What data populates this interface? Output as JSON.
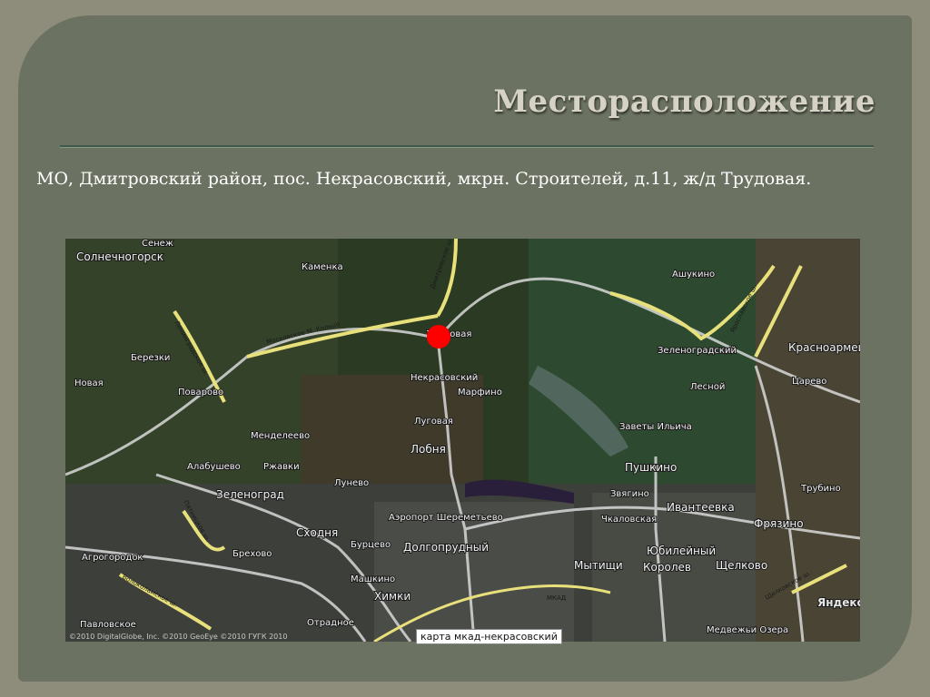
{
  "slide": {
    "title": "Месторасположение",
    "address": "МО, Дмитровский район, пос. Некрасовский, мкрн. Строителей, д.11, ж/д Трудовая."
  },
  "map": {
    "caption": "карта мкад-некрасовский",
    "copyright": "©2010 DigitalGlobe, Inc. ©2010 GeoEye ©2010 ГУГК 2010",
    "logo": "Яндекс",
    "marker_color": "#ff0000",
    "places": [
      {
        "name": "Сенеж"
      },
      {
        "name": "Солнечногорск"
      },
      {
        "name": "Каменка"
      },
      {
        "name": "Трудовая"
      },
      {
        "name": "Ашукино"
      },
      {
        "name": "Березки"
      },
      {
        "name": "Поварово"
      },
      {
        "name": "Некрасовский"
      },
      {
        "name": "Марфино"
      },
      {
        "name": "Зеленоградский"
      },
      {
        "name": "Лесной"
      },
      {
        "name": "Красноармейск"
      },
      {
        "name": "Царево"
      },
      {
        "name": "Новая"
      },
      {
        "name": "Луговая"
      },
      {
        "name": "Менделеево"
      },
      {
        "name": "Лобня"
      },
      {
        "name": "Заветы Ильича"
      },
      {
        "name": "Алабушево"
      },
      {
        "name": "Ржавки"
      },
      {
        "name": "Лунево"
      },
      {
        "name": "Пушкино"
      },
      {
        "name": "Трубино"
      },
      {
        "name": "Зеленоград"
      },
      {
        "name": "Звягино"
      },
      {
        "name": "Ивантеевка"
      },
      {
        "name": "Аэропорт Шереметьево"
      },
      {
        "name": "Сходня"
      },
      {
        "name": "Чкаловская"
      },
      {
        "name": "Фрязино"
      },
      {
        "name": "Бурцево"
      },
      {
        "name": "Брехово"
      },
      {
        "name": "Долгопрудный"
      },
      {
        "name": "Юбилейный"
      },
      {
        "name": "Агрогородок"
      },
      {
        "name": "Мытищи"
      },
      {
        "name": "Королев"
      },
      {
        "name": "Щелково"
      },
      {
        "name": "Машкино"
      },
      {
        "name": "Химки"
      },
      {
        "name": "Павловское"
      },
      {
        "name": "Отрадное"
      },
      {
        "name": "Медвежьи Озера"
      }
    ],
    "roads": [
      {
        "name": "Московское М. Кольцо"
      },
      {
        "name": "Дмитровское ш."
      },
      {
        "name": "Ленинградское ш."
      },
      {
        "name": "Ярославское ш."
      },
      {
        "name": "Пятницкое ш."
      },
      {
        "name": "Волоколамское ш."
      },
      {
        "name": "МКАД"
      },
      {
        "name": "Щелковское ш."
      }
    ]
  }
}
